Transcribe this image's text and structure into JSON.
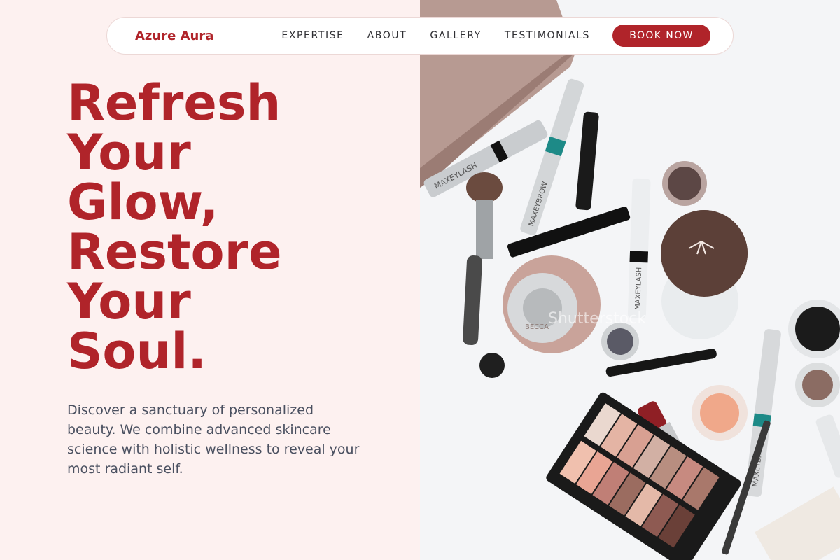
{
  "nav": {
    "brand": "Azure Aura",
    "links": [
      "EXPERTISE",
      "ABOUT",
      "GALLERY",
      "TESTIMONIALS"
    ],
    "cta": "BOOK NOW"
  },
  "hero": {
    "headline_lines": [
      "Refresh",
      "Your",
      "Glow,",
      "Restore",
      "Your",
      "Soul."
    ],
    "description": "Discover a sanctuary of personalized beauty. We combine advanced skincare science with holistic wellness to reveal your most radiant self."
  },
  "image": {
    "product_labels": [
      "MAXEYLASH",
      "MAXEYBROW",
      "MAXEYLASH",
      "MAXEYBROW",
      "BECCA"
    ],
    "watermark": "Shutterstock"
  },
  "colors": {
    "accent": "#b0242a",
    "left_background": "#fdf1f0",
    "body_text": "#4a5060",
    "nav_text": "#2f2f33"
  }
}
